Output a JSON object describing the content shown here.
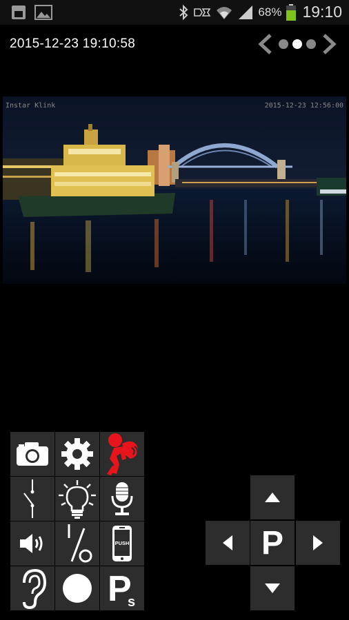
{
  "status_bar": {
    "battery_percent": "68%",
    "time": "19:10",
    "icons": [
      "sim-card-icon",
      "image-notification-icon",
      "bluetooth-icon",
      "signal-exchange-icon",
      "wifi-icon",
      "cell-signal-icon",
      "battery-icon"
    ]
  },
  "header": {
    "datetime": "2015-12-23 19:10:58",
    "pager": {
      "pages": 3,
      "active_index": 1
    }
  },
  "video": {
    "overlay_left": "Instar Klink",
    "overlay_right": "2015-12-23 12:56:00"
  },
  "controls": [
    [
      "camera-icon",
      "settings-gear-icon",
      "alarm-burglar-icon"
    ],
    [
      "switch-icon",
      "light-bulb-icon",
      "microphone-icon"
    ],
    [
      "speaker-icon",
      "percent-icon",
      "push-phone-icon"
    ],
    [
      "ear-icon",
      "record-icon",
      "preset-ps-icon"
    ]
  ],
  "push_label": "PUSH",
  "preset_label": "P",
  "preset_sub": "s",
  "dpad": {
    "center_label": "P"
  },
  "colors": {
    "alarm_red": "#e8141b",
    "button_bg": "#2d2d2d",
    "battery_green": "#7dc31b"
  }
}
